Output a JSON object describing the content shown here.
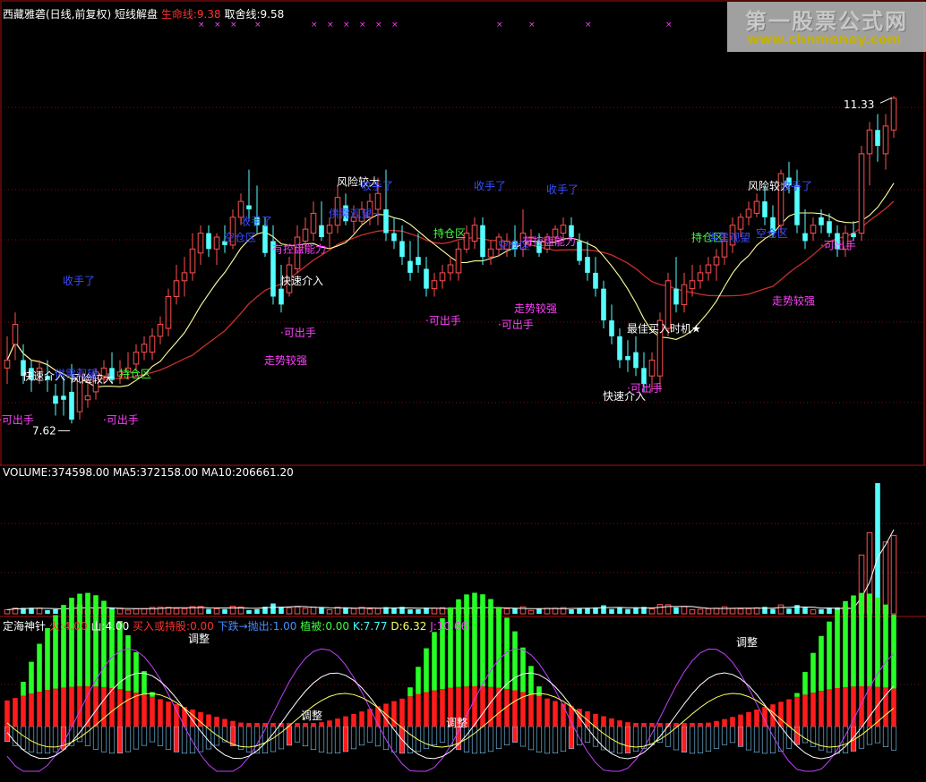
{
  "main_header": {
    "stock_name": "西藏雅砻(日线,前复权)",
    "indicator_name": "短线解盘",
    "life_line_label": "生命线:9.38",
    "take_line_label": "取舍线:9.58"
  },
  "volume_header": {
    "volume": "VOLUME:374598.00",
    "ma5": "MA5:372158.00",
    "ma10": "MA10:206661.20"
  },
  "indicator_header": {
    "name": "定海神针",
    "fire": "火:4.00",
    "mountain": "山:4.00",
    "buy_hold": "买入或持股:0.00",
    "fall_sell": "下跌→抛出:1.00",
    "vegetation": "植被:0.00",
    "k": "K:7.77",
    "d": "D:6.32",
    "j": "J:10.66"
  },
  "watermark": {
    "title": "第一股票公式网",
    "url": "www.chnmoney.com"
  },
  "colors": {
    "up": "#ff5050",
    "down": "#54ffff",
    "life_line": "#ffff9e",
    "take_line": "#c8302c",
    "label_blue": "#3a4dff",
    "label_magenta": "#ff40ff",
    "label_white": "#ffffff",
    "label_green": "#40ff40",
    "bar_green": "#26ff26",
    "bar_red": "#ff1c1c",
    "grid_red": "#aa1010"
  },
  "chart_data": {
    "type": "candlestick",
    "price_range": [
      6.9,
      12.2
    ],
    "high_label": "11.33",
    "low_label": "7.62",
    "candles": [
      {
        "o": 7.9,
        "h": 8.3,
        "l": 7.7,
        "c": 8.0
      },
      {
        "o": 8.2,
        "h": 8.6,
        "l": 8.0,
        "c": 8.45
      },
      {
        "o": 8.0,
        "h": 8.2,
        "l": 7.7,
        "c": 7.8
      },
      {
        "o": 7.9,
        "h": 8.0,
        "l": 7.6,
        "c": 7.75
      },
      {
        "o": 7.85,
        "h": 8.0,
        "l": 7.7,
        "c": 7.9
      },
      {
        "o": 7.8,
        "h": 8.0,
        "l": 7.6,
        "c": 7.75
      },
      {
        "o": 7.55,
        "h": 7.7,
        "l": 7.3,
        "c": 7.45
      },
      {
        "o": 7.55,
        "h": 7.8,
        "l": 7.3,
        "c": 7.5
      },
      {
        "o": 7.6,
        "h": 7.95,
        "l": 7.2,
        "c": 7.25
      },
      {
        "o": 7.35,
        "h": 7.9,
        "l": 7.25,
        "c": 7.8
      },
      {
        "o": 7.5,
        "h": 7.8,
        "l": 7.4,
        "c": 7.55
      },
      {
        "o": 7.6,
        "h": 7.9,
        "l": 7.5,
        "c": 7.85
      },
      {
        "o": 7.8,
        "h": 8.0,
        "l": 7.7,
        "c": 7.9
      },
      {
        "o": 7.9,
        "h": 8.1,
        "l": 7.7,
        "c": 7.75
      },
      {
        "o": 7.8,
        "h": 8.0,
        "l": 7.7,
        "c": 7.85
      },
      {
        "o": 7.85,
        "h": 8.1,
        "l": 7.75,
        "c": 7.9
      },
      {
        "o": 7.95,
        "h": 8.2,
        "l": 7.85,
        "c": 8.1
      },
      {
        "o": 8.1,
        "h": 8.3,
        "l": 8.0,
        "c": 8.2
      },
      {
        "o": 8.1,
        "h": 8.4,
        "l": 8.0,
        "c": 8.3
      },
      {
        "o": 8.3,
        "h": 8.55,
        "l": 8.2,
        "c": 8.45
      },
      {
        "o": 8.4,
        "h": 8.9,
        "l": 8.3,
        "c": 8.8
      },
      {
        "o": 8.8,
        "h": 9.2,
        "l": 8.7,
        "c": 9.0
      },
      {
        "o": 9.0,
        "h": 9.3,
        "l": 8.8,
        "c": 9.1
      },
      {
        "o": 9.1,
        "h": 9.6,
        "l": 9.0,
        "c": 9.4
      },
      {
        "o": 9.35,
        "h": 9.7,
        "l": 9.2,
        "c": 9.6
      },
      {
        "o": 9.6,
        "h": 9.7,
        "l": 9.3,
        "c": 9.4
      },
      {
        "o": 9.4,
        "h": 9.6,
        "l": 9.2,
        "c": 9.55
      },
      {
        "o": 9.5,
        "h": 9.7,
        "l": 9.35,
        "c": 9.45
      },
      {
        "o": 9.45,
        "h": 9.9,
        "l": 9.4,
        "c": 9.8
      },
      {
        "o": 9.8,
        "h": 10.1,
        "l": 9.7,
        "c": 10.0
      },
      {
        "o": 9.95,
        "h": 10.4,
        "l": 9.75,
        "c": 9.9
      },
      {
        "o": 9.8,
        "h": 10.2,
        "l": 9.6,
        "c": 9.7
      },
      {
        "o": 9.7,
        "h": 9.8,
        "l": 9.3,
        "c": 9.35
      },
      {
        "o": 9.5,
        "h": 9.7,
        "l": 8.7,
        "c": 8.8
      },
      {
        "o": 8.9,
        "h": 9.2,
        "l": 8.6,
        "c": 8.7
      },
      {
        "o": 8.85,
        "h": 9.3,
        "l": 8.8,
        "c": 9.2
      },
      {
        "o": 9.15,
        "h": 9.7,
        "l": 9.1,
        "c": 9.55
      },
      {
        "o": 9.5,
        "h": 9.8,
        "l": 9.4,
        "c": 9.65
      },
      {
        "o": 9.6,
        "h": 10.0,
        "l": 9.5,
        "c": 9.85
      },
      {
        "o": 9.7,
        "h": 10.0,
        "l": 9.5,
        "c": 9.55
      },
      {
        "o": 9.6,
        "h": 9.8,
        "l": 9.4,
        "c": 9.7
      },
      {
        "o": 9.7,
        "h": 10.2,
        "l": 9.6,
        "c": 10.05
      },
      {
        "o": 9.95,
        "h": 10.1,
        "l": 9.7,
        "c": 9.75
      },
      {
        "o": 9.75,
        "h": 9.95,
        "l": 9.6,
        "c": 9.8
      },
      {
        "o": 9.75,
        "h": 10.0,
        "l": 9.7,
        "c": 9.9
      },
      {
        "o": 9.8,
        "h": 10.1,
        "l": 9.7,
        "c": 10.0
      },
      {
        "o": 9.9,
        "h": 10.3,
        "l": 9.7,
        "c": 10.1
      },
      {
        "o": 9.9,
        "h": 10.4,
        "l": 9.5,
        "c": 9.6
      },
      {
        "o": 9.6,
        "h": 9.8,
        "l": 9.4,
        "c": 9.5
      },
      {
        "o": 9.5,
        "h": 9.7,
        "l": 9.2,
        "c": 9.3
      },
      {
        "o": 9.25,
        "h": 9.5,
        "l": 9.0,
        "c": 9.1
      },
      {
        "o": 9.3,
        "h": 9.6,
        "l": 9.1,
        "c": 9.2
      },
      {
        "o": 9.15,
        "h": 9.3,
        "l": 8.8,
        "c": 8.9
      },
      {
        "o": 8.9,
        "h": 9.1,
        "l": 8.8,
        "c": 9.0
      },
      {
        "o": 9.0,
        "h": 9.2,
        "l": 8.9,
        "c": 9.1
      },
      {
        "o": 9.1,
        "h": 9.3,
        "l": 9.0,
        "c": 9.2
      },
      {
        "o": 9.1,
        "h": 9.5,
        "l": 9.0,
        "c": 9.4
      },
      {
        "o": 9.4,
        "h": 9.7,
        "l": 9.35,
        "c": 9.6
      },
      {
        "o": 9.5,
        "h": 9.8,
        "l": 9.4,
        "c": 9.7
      },
      {
        "o": 9.7,
        "h": 9.8,
        "l": 9.2,
        "c": 9.3
      },
      {
        "o": 9.3,
        "h": 9.5,
        "l": 9.2,
        "c": 9.4
      },
      {
        "o": 9.4,
        "h": 9.6,
        "l": 9.3,
        "c": 9.55
      },
      {
        "o": 9.4,
        "h": 9.6,
        "l": 9.3,
        "c": 9.5
      },
      {
        "o": 9.5,
        "h": 9.7,
        "l": 9.3,
        "c": 9.4
      },
      {
        "o": 9.4,
        "h": 9.9,
        "l": 9.3,
        "c": 9.6
      },
      {
        "o": 9.55,
        "h": 9.65,
        "l": 9.45,
        "c": 9.55
      },
      {
        "o": 9.5,
        "h": 9.6,
        "l": 9.3,
        "c": 9.35
      },
      {
        "o": 9.4,
        "h": 9.6,
        "l": 9.35,
        "c": 9.55
      },
      {
        "o": 9.55,
        "h": 9.7,
        "l": 9.5,
        "c": 9.65
      },
      {
        "o": 9.6,
        "h": 9.8,
        "l": 9.5,
        "c": 9.7
      },
      {
        "o": 9.7,
        "h": 9.8,
        "l": 9.5,
        "c": 9.55
      },
      {
        "o": 9.5,
        "h": 9.6,
        "l": 9.2,
        "c": 9.25
      },
      {
        "o": 9.3,
        "h": 9.5,
        "l": 9.0,
        "c": 9.1
      },
      {
        "o": 9.1,
        "h": 9.3,
        "l": 8.8,
        "c": 8.9
      },
      {
        "o": 8.9,
        "h": 9.0,
        "l": 8.4,
        "c": 8.5
      },
      {
        "o": 8.5,
        "h": 8.7,
        "l": 8.2,
        "c": 8.3
      },
      {
        "o": 8.3,
        "h": 8.4,
        "l": 7.9,
        "c": 8.0
      },
      {
        "o": 8.05,
        "h": 8.25,
        "l": 7.85,
        "c": 8.0
      },
      {
        "o": 8.1,
        "h": 8.3,
        "l": 7.8,
        "c": 7.9
      },
      {
        "o": 7.9,
        "h": 8.1,
        "l": 7.6,
        "c": 7.7
      },
      {
        "o": 7.8,
        "h": 8.1,
        "l": 7.6,
        "c": 8.0
      },
      {
        "o": 7.8,
        "h": 8.6,
        "l": 7.6,
        "c": 8.5
      },
      {
        "o": 8.4,
        "h": 9.1,
        "l": 8.3,
        "c": 9.0
      },
      {
        "o": 8.9,
        "h": 9.3,
        "l": 8.6,
        "c": 8.7
      },
      {
        "o": 8.7,
        "h": 9.1,
        "l": 8.6,
        "c": 8.95
      },
      {
        "o": 8.9,
        "h": 9.2,
        "l": 8.8,
        "c": 9.0
      },
      {
        "o": 9.0,
        "h": 9.2,
        "l": 8.9,
        "c": 9.1
      },
      {
        "o": 9.1,
        "h": 9.3,
        "l": 9.0,
        "c": 9.2
      },
      {
        "o": 9.2,
        "h": 9.4,
        "l": 9.0,
        "c": 9.3
      },
      {
        "o": 9.3,
        "h": 9.6,
        "l": 9.2,
        "c": 9.5
      },
      {
        "o": 9.45,
        "h": 9.8,
        "l": 9.35,
        "c": 9.7
      },
      {
        "o": 9.65,
        "h": 9.85,
        "l": 9.55,
        "c": 9.8
      },
      {
        "o": 9.8,
        "h": 10.0,
        "l": 9.7,
        "c": 9.9
      },
      {
        "o": 9.85,
        "h": 10.1,
        "l": 9.8,
        "c": 10.0
      },
      {
        "o": 10.0,
        "h": 10.2,
        "l": 9.7,
        "c": 9.8
      },
      {
        "o": 9.8,
        "h": 9.95,
        "l": 9.55,
        "c": 9.6
      },
      {
        "o": 9.7,
        "h": 10.4,
        "l": 9.6,
        "c": 10.35
      },
      {
        "o": 10.3,
        "h": 10.5,
        "l": 10.1,
        "c": 10.2
      },
      {
        "o": 10.2,
        "h": 10.4,
        "l": 9.6,
        "c": 9.7
      },
      {
        "o": 9.6,
        "h": 9.9,
        "l": 9.4,
        "c": 9.5
      },
      {
        "o": 9.6,
        "h": 9.8,
        "l": 9.5,
        "c": 9.7
      },
      {
        "o": 9.8,
        "h": 9.9,
        "l": 9.6,
        "c": 9.7
      },
      {
        "o": 9.75,
        "h": 9.85,
        "l": 9.55,
        "c": 9.6
      },
      {
        "o": 9.6,
        "h": 9.7,
        "l": 9.3,
        "c": 9.4
      },
      {
        "o": 9.4,
        "h": 9.7,
        "l": 9.3,
        "c": 9.6
      },
      {
        "o": 9.6,
        "h": 9.75,
        "l": 9.5,
        "c": 9.55
      },
      {
        "o": 9.6,
        "h": 10.7,
        "l": 9.5,
        "c": 10.6
      },
      {
        "o": 10.6,
        "h": 11.0,
        "l": 10.2,
        "c": 10.9
      },
      {
        "o": 10.9,
        "h": 11.1,
        "l": 10.5,
        "c": 10.7
      },
      {
        "o": 10.6,
        "h": 11.1,
        "l": 10.4,
        "c": 10.95
      },
      {
        "o": 10.9,
        "h": 11.33,
        "l": 10.8,
        "c": 11.3
      }
    ],
    "annotations": [
      {
        "text": "快速介入",
        "idx": 3,
        "price": 7.75,
        "color": "white"
      },
      {
        "text": "风险较大",
        "idx": 9,
        "price": 7.72,
        "color": "white"
      },
      {
        "text": "持仓区",
        "idx": 15,
        "price": 7.78,
        "color": "green"
      },
      {
        "text": "供需观望",
        "idx": 7,
        "price": 7.78,
        "color": "blue"
      },
      {
        "text": "·可出手",
        "idx": 0,
        "price": 7.2,
        "color": "magenta"
      },
      {
        "text": "·可出手",
        "idx": 13,
        "price": 7.2,
        "color": "magenta"
      },
      {
        "text": "收手了",
        "idx": 8,
        "price": 8.95,
        "color": "blue"
      },
      {
        "text": "收手了",
        "idx": 30,
        "price": 9.7,
        "color": "blue"
      },
      {
        "text": "空仓区",
        "idx": 28,
        "price": 9.5,
        "color": "blue"
      },
      {
        "text": "有控盘能力",
        "idx": 34,
        "price": 9.35,
        "color": "magenta"
      },
      {
        "text": "快速介入",
        "idx": 35,
        "price": 8.95,
        "color": "white"
      },
      {
        "text": "·可出手",
        "idx": 35,
        "price": 8.3,
        "color": "magenta"
      },
      {
        "text": "走势较强",
        "idx": 33,
        "price": 7.95,
        "color": "magenta"
      },
      {
        "text": "风险较大",
        "idx": 42,
        "price": 10.2,
        "color": "white"
      },
      {
        "text": "收手了",
        "idx": 45,
        "price": 10.15,
        "color": "blue"
      },
      {
        "text": "供需观望~",
        "idx": 41,
        "price": 9.8,
        "color": "blue"
      },
      {
        "text": "持仓区",
        "idx": 54,
        "price": 9.55,
        "color": "green"
      },
      {
        "text": "·可出手",
        "idx": 53,
        "price": 8.45,
        "color": "magenta"
      },
      {
        "text": "收手了",
        "idx": 59,
        "price": 10.15,
        "color": "blue"
      },
      {
        "text": "收手了",
        "idx": 68,
        "price": 10.1,
        "color": "blue"
      },
      {
        "text": "空仓区",
        "idx": 62,
        "price": 9.4,
        "color": "blue"
      },
      {
        "text": "有控盘能力",
        "idx": 65,
        "price": 9.45,
        "color": "magenta"
      },
      {
        "text": "走势较强",
        "idx": 64,
        "price": 8.6,
        "color": "magenta"
      },
      {
        "text": "·可出手",
        "idx": 62,
        "price": 8.4,
        "color": "magenta"
      },
      {
        "text": "最佳买入时机★",
        "idx": 78,
        "price": 8.35,
        "color": "white"
      },
      {
        "text": "快速介入",
        "idx": 75,
        "price": 7.5,
        "color": "white"
      },
      {
        "text": "·可出手",
        "idx": 78,
        "price": 7.6,
        "color": "magenta"
      },
      {
        "text": "持仓区",
        "idx": 86,
        "price": 9.5,
        "color": "green"
      },
      {
        "text": "供需观望",
        "idx": 88,
        "price": 9.5,
        "color": "blue"
      },
      {
        "text": "空仓区",
        "idx": 94,
        "price": 9.55,
        "color": "blue"
      },
      {
        "text": "风险较大",
        "idx": 93,
        "price": 10.15,
        "color": "white"
      },
      {
        "text": "收手了",
        "idx": 97,
        "price": 10.15,
        "color": "blue"
      },
      {
        "text": "走势较强",
        "idx": 96,
        "price": 8.7,
        "color": "magenta"
      },
      {
        "text": "·可出手",
        "idx": 102,
        "price": 9.4,
        "color": "magenta"
      }
    ]
  }
}
